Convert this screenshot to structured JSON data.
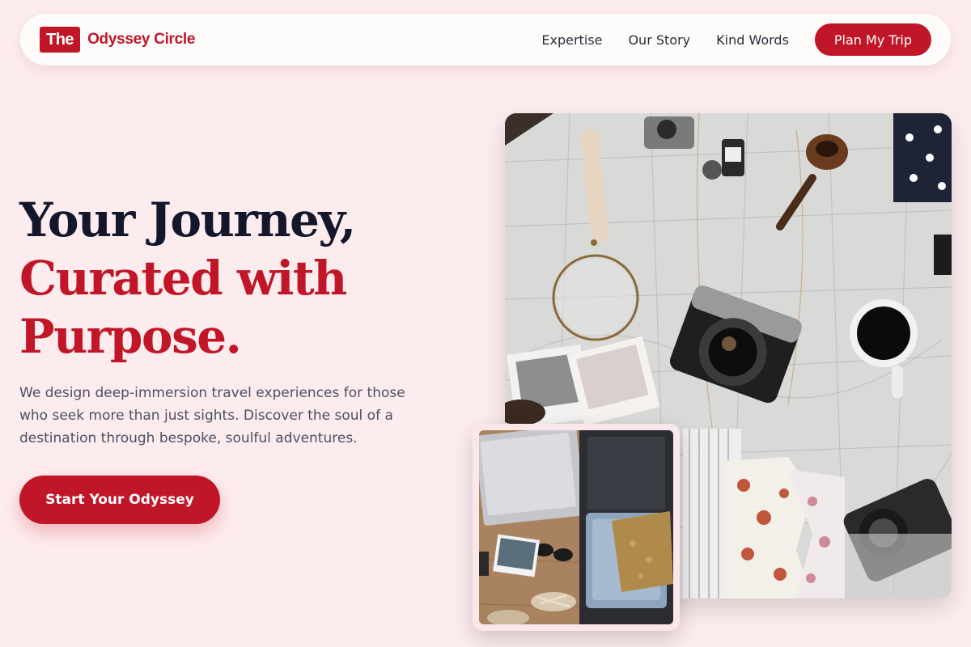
{
  "brand": {
    "badge": "The",
    "name": "Odyssey Circle",
    "accent_color": "#c01628"
  },
  "nav": {
    "links": [
      "Expertise",
      "Our Story",
      "Kind Words"
    ],
    "cta_label": "Plan My Trip"
  },
  "hero": {
    "headline_line1": "Your Journey,",
    "headline_line2": "Curated with",
    "headline_line3": "Purpose.",
    "subtext": "We design deep-immersion travel experiences for those who seek more than just sights. Discover the soul of a destination through bespoke, soulful adventures.",
    "cta_label": "Start Your Odyssey"
  },
  "images": {
    "main_photo_icon": "travel-flatlay-map-photo",
    "inset_photo_icon": "packed-suitcase-photo"
  }
}
